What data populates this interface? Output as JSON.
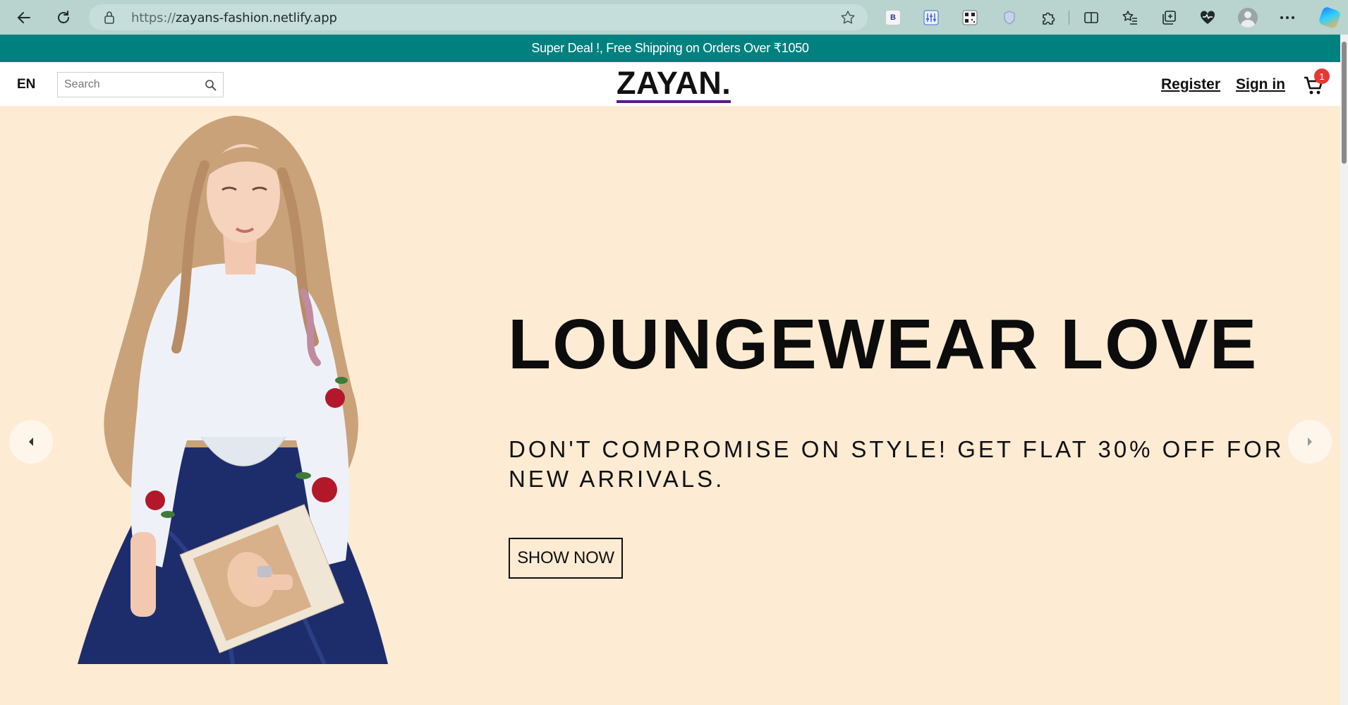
{
  "browser": {
    "url_protocol": "https://",
    "url_host": "zayans-fashion.netlify.app",
    "extensions": [
      "B"
    ]
  },
  "promo": {
    "text": "Super Deal !, Free Shipping on Orders Over ₹1050"
  },
  "header": {
    "language": "EN",
    "search_placeholder": "Search",
    "logo": "ZAYAN.",
    "register_label": "Register",
    "signin_label": "Sign in",
    "cart_count": "1"
  },
  "hero": {
    "title": "LOUNGEWEAR LOVE",
    "subtitle": "DON'T COMPROMISE ON STYLE! GET FLAT 30% OFF FOR NEW ARRIVALS.",
    "cta_label": "SHOW NOW"
  },
  "colors": {
    "promo_bg": "#00817f",
    "hero_bg": "#fdebd3",
    "logo_underline": "#5b1a8a",
    "badge": "#e53935",
    "chrome": "#b9d3cf"
  }
}
